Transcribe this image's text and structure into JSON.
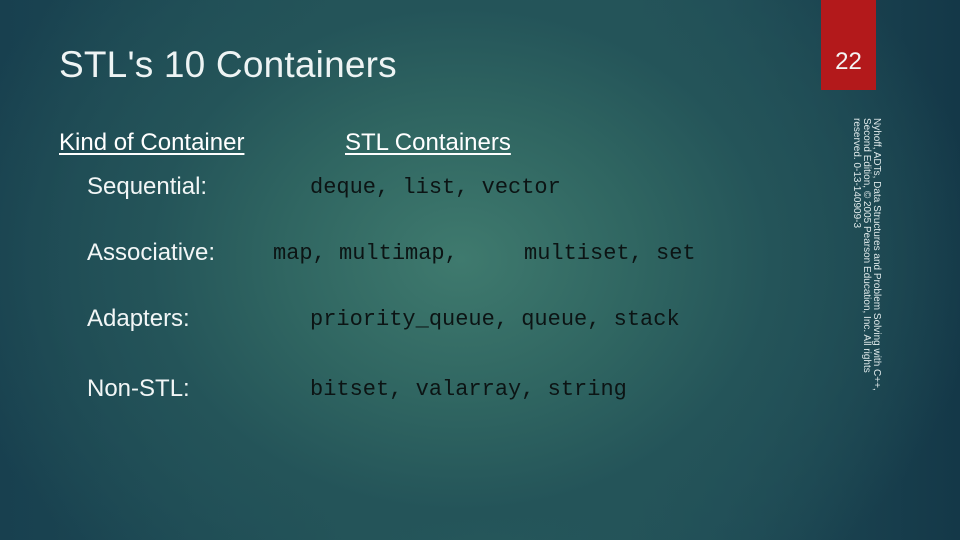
{
  "slide": {
    "title": "STL's 10 Containers",
    "page_number": "22",
    "copyright": "Nyhoff, ADTs, Data Structures and Problem Solving with C++, Second Edition, © 2005 Pearson Education, Inc. All rights reserved. 0-13-140909-3",
    "colors": {
      "badge": "#b3191b",
      "background": "#245459"
    }
  },
  "table": {
    "headers": {
      "kind": "Kind of Container",
      "stl": "STL Containers"
    },
    "rows": [
      {
        "kind": "Sequential:",
        "containers": "deque, list, vector"
      },
      {
        "kind": "Associative:",
        "containers_a": "map, multimap,",
        "containers_b": "multiset, set"
      },
      {
        "kind": "Adapters:",
        "containers": "priority_queue, queue, stack"
      },
      {
        "kind": "Non-STL:",
        "containers": "bitset, valarray, string"
      }
    ]
  }
}
